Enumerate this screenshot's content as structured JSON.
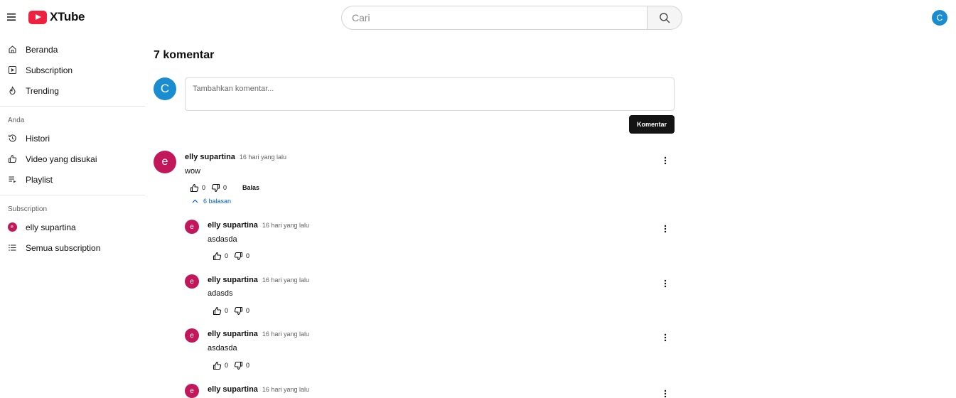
{
  "app": {
    "name": "XTube",
    "accent": "#f0213e"
  },
  "header": {
    "search_placeholder": "Cari",
    "user_initial": "C",
    "user_avatar_color": "#1a8cd0"
  },
  "sidebar": {
    "main_items": [
      {
        "label": "Beranda",
        "icon": "home-icon"
      },
      {
        "label": "Subscription",
        "icon": "subscription-icon"
      },
      {
        "label": "Trending",
        "icon": "flame-icon"
      }
    ],
    "you_title": "Anda",
    "you_items": [
      {
        "label": "Histori",
        "icon": "history-icon"
      },
      {
        "label": "Video yang disukai",
        "icon": "thumb-up-icon"
      },
      {
        "label": "Playlist",
        "icon": "playlist-icon"
      }
    ],
    "subs_title": "Subscription",
    "subs_items": [
      {
        "label": "elly supartina",
        "initial": "e"
      },
      {
        "label": "Semua subscription",
        "icon": "list-icon"
      }
    ]
  },
  "comments": {
    "title": "7 komentar",
    "composer": {
      "initial": "C",
      "placeholder": "Tambahkan komentar...",
      "submit_label": "Komentar"
    },
    "top": {
      "initial": "e",
      "author": "elly supartina",
      "time": "16 hari yang lalu",
      "text": "wow",
      "likes": "0",
      "dislikes": "0",
      "reply_label": "Balas",
      "replies_label": "6 balasan"
    },
    "replies": [
      {
        "initial": "e",
        "author": "elly supartina",
        "time": "16 hari yang lalu",
        "text": "asdasda",
        "likes": "0",
        "dislikes": "0"
      },
      {
        "initial": "e",
        "author": "elly supartina",
        "time": "16 hari yang lalu",
        "text": "adasds",
        "likes": "0",
        "dislikes": "0"
      },
      {
        "initial": "e",
        "author": "elly supartina",
        "time": "16 hari yang lalu",
        "text": "asdasda",
        "likes": "0",
        "dislikes": "0"
      },
      {
        "initial": "e",
        "author": "elly supartina",
        "time": "16 hari yang lalu"
      }
    ],
    "author_avatar_color": "#c2185b"
  }
}
